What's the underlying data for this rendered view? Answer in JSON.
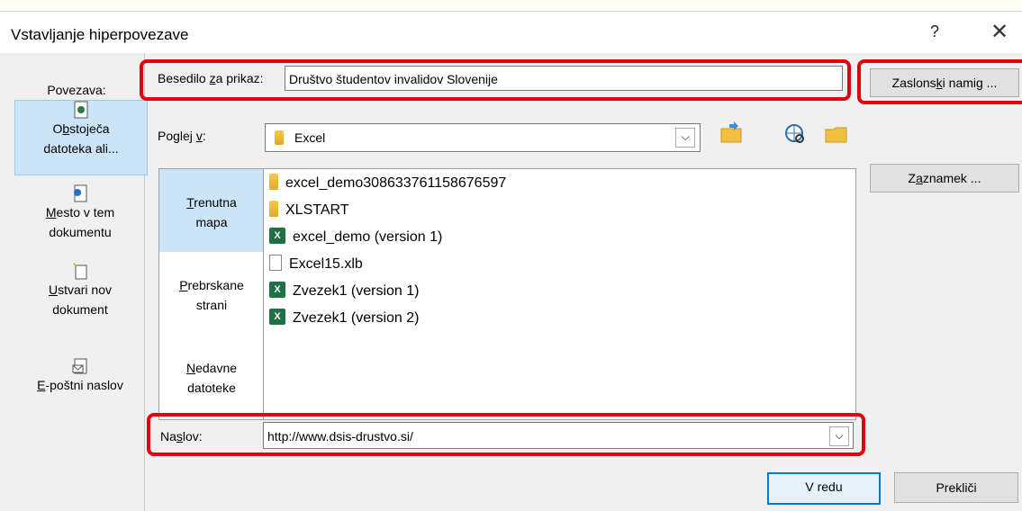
{
  "window": {
    "title": "Vstavljanje hiperpovezave",
    "help": "?",
    "close": "✕"
  },
  "left_pane": {
    "header": "Povezava:",
    "items": [
      {
        "pre": "O",
        "u": "b",
        "post": "stoječa",
        "line2": "datoteka ali...",
        "icon": "existing-file-icon",
        "selected": true
      },
      {
        "pre": "",
        "u": "M",
        "post": "esto v tem",
        "line2": "dokumentu",
        "icon": "place-in-document-icon"
      },
      {
        "pre": "",
        "u": "U",
        "post": "stvari nov",
        "line2": "dokument",
        "icon": "new-document-icon"
      },
      {
        "pre": "",
        "u": "E",
        "post": "-poštni naslov",
        "line2": "",
        "icon": "email-address-icon"
      }
    ]
  },
  "display_text": {
    "label_pre": "Besedilo ",
    "label_u": "z",
    "label_post": "a prikaz:",
    "value": "Društvo študentov invalidov Slovenije"
  },
  "screentip_button": {
    "pre": "Zaslons",
    "u": "k",
    "post": "i namig ..."
  },
  "look_in": {
    "label_pre": "Poglej ",
    "label_u": "v",
    "label_post": ":",
    "value": "Excel",
    "chevron": "⌵"
  },
  "bookmark_button": {
    "pre": "Z",
    "u": "a",
    "post": "znamek ..."
  },
  "places": [
    {
      "u": "T",
      "post": "renutna",
      "line2": "mapa",
      "selected": true
    },
    {
      "u": "P",
      "post": "rebrskane",
      "line2": "strani"
    },
    {
      "u": "N",
      "post": "edavne",
      "line2": "datoteke"
    }
  ],
  "files": [
    {
      "name": "excel_demo308633761158676597",
      "type": "folder"
    },
    {
      "name": "XLSTART",
      "type": "folder"
    },
    {
      "name": "excel_demo (version 1)",
      "type": "xlsx"
    },
    {
      "name": "Excel15.xlb",
      "type": "file"
    },
    {
      "name": "Zvezek1 (version 1)",
      "type": "xlsx"
    },
    {
      "name": "Zvezek1 (version 2)",
      "type": "xlsx"
    }
  ],
  "address": {
    "label_pre": "Na",
    "label_u": "s",
    "label_post": "lov:",
    "value": "http://www.dsis-drustvo.si/",
    "chevron": "⌵"
  },
  "ok_button": "V redu",
  "cancel_button": "Prekliči",
  "highlight_color": "#e3000f"
}
